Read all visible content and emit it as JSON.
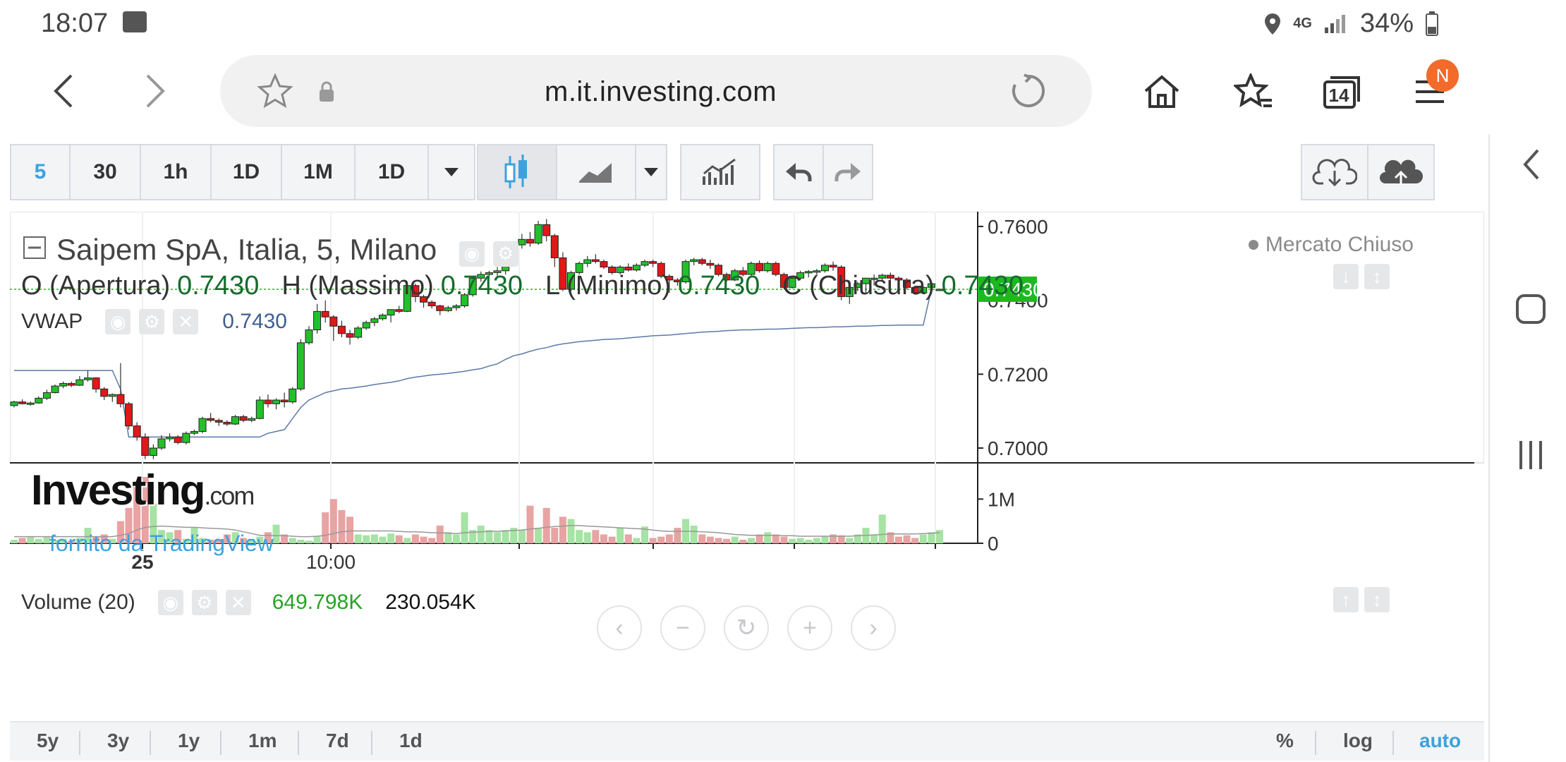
{
  "status_bar": {
    "time": "18:07",
    "network": "4G",
    "battery": "34%",
    "icons": [
      "wifi-icon",
      "location-icon",
      "signal-icon",
      "battery-icon"
    ]
  },
  "browser": {
    "url": "m.it.investing.com",
    "tab_count": "14",
    "notification_badge": "N",
    "icons": [
      "back-icon",
      "forward-icon",
      "star-icon",
      "lock-icon",
      "reload-icon",
      "home-icon",
      "bookmark-star-icon",
      "tabs-icon",
      "menu-icon"
    ]
  },
  "toolbar": {
    "intervals": [
      "5",
      "30",
      "1h",
      "1D",
      "1M",
      "1D"
    ],
    "active_interval": "5",
    "chart_style_icons": [
      "candlestick-icon",
      "line-chart-icon",
      "dropdown-icon"
    ],
    "indicators_icon": "indicators-icon",
    "undo_icon": "undo-icon",
    "redo_icon": "redo-icon",
    "save_icons": [
      "cloud-download-icon",
      "cloud-upload-icon"
    ]
  },
  "legend": {
    "title": "Saipem SpA, Italia, 5, Milano",
    "market_status": "Mercato Chiuso",
    "ohlc": [
      {
        "label": "O (Apertura)",
        "value": "0.7430"
      },
      {
        "label": "H (Massimo)",
        "value": "0.7430"
      },
      {
        "label": "L (Minimo)",
        "value": "0.7430"
      },
      {
        "label": "C (Chiusura)",
        "value": "0.7430"
      }
    ],
    "vwap_label": "VWAP",
    "vwap_value": "0.7430"
  },
  "volume": {
    "label": "Volume (20)",
    "value_a": "649.798K",
    "value_b": "230.054K"
  },
  "watermark": {
    "logo": "Investing",
    "logo_suffix": ".com",
    "provider": "fornito da TradingView"
  },
  "chart_data": {
    "type": "candlestick",
    "price_axis": {
      "ticks": [
        "0.7600",
        "0.7400",
        "0.7200",
        "0.7000"
      ],
      "range": [
        0.696,
        0.764
      ],
      "last_price_label": "0.7430",
      "last_price": 0.743
    },
    "volume_axis": {
      "ticks": [
        "1M",
        "0"
      ],
      "range": [
        0,
        1.5
      ]
    },
    "time_axis": {
      "ticks": [
        "25",
        "10:00"
      ]
    },
    "candles": [
      [
        0.7115,
        0.7128,
        0.711,
        0.7125
      ],
      [
        0.7125,
        0.7132,
        0.7118,
        0.712
      ],
      [
        0.712,
        0.7126,
        0.7115,
        0.7122
      ],
      [
        0.7122,
        0.714,
        0.712,
        0.7135
      ],
      [
        0.7135,
        0.7158,
        0.713,
        0.715
      ],
      [
        0.715,
        0.7172,
        0.7148,
        0.7168
      ],
      [
        0.7168,
        0.718,
        0.7162,
        0.7175
      ],
      [
        0.7175,
        0.718,
        0.7165,
        0.717
      ],
      [
        0.717,
        0.7195,
        0.7168,
        0.7185
      ],
      [
        0.7185,
        0.721,
        0.718,
        0.719
      ],
      [
        0.719,
        0.7192,
        0.715,
        0.716
      ],
      [
        0.716,
        0.7165,
        0.713,
        0.714
      ],
      [
        0.714,
        0.7148,
        0.7125,
        0.7145
      ],
      [
        0.7145,
        0.723,
        0.711,
        0.712
      ],
      [
        0.712,
        0.7125,
        0.705,
        0.706
      ],
      [
        0.706,
        0.707,
        0.702,
        0.703
      ],
      [
        0.703,
        0.704,
        0.697,
        0.698
      ],
      [
        0.698,
        0.701,
        0.697,
        0.7
      ],
      [
        0.7,
        0.7035,
        0.6995,
        0.7025
      ],
      [
        0.7025,
        0.704,
        0.7018,
        0.703
      ],
      [
        0.703,
        0.7035,
        0.701,
        0.7015
      ],
      [
        0.7015,
        0.7045,
        0.701,
        0.704
      ],
      [
        0.704,
        0.705,
        0.7035,
        0.7045
      ],
      [
        0.7045,
        0.7085,
        0.704,
        0.708
      ],
      [
        0.708,
        0.7095,
        0.707,
        0.7075
      ],
      [
        0.7075,
        0.708,
        0.706,
        0.707
      ],
      [
        0.707,
        0.7075,
        0.706,
        0.7065
      ],
      [
        0.7065,
        0.709,
        0.7062,
        0.7085
      ],
      [
        0.7085,
        0.709,
        0.707,
        0.7075
      ],
      [
        0.7075,
        0.7085,
        0.707,
        0.708
      ],
      [
        0.708,
        0.714,
        0.7078,
        0.713
      ],
      [
        0.713,
        0.7145,
        0.711,
        0.712
      ],
      [
        0.712,
        0.7135,
        0.7105,
        0.713
      ],
      [
        0.713,
        0.715,
        0.711,
        0.7125
      ],
      [
        0.7125,
        0.7165,
        0.712,
        0.716
      ],
      [
        0.716,
        0.7295,
        0.7155,
        0.7285
      ],
      [
        0.7285,
        0.733,
        0.728,
        0.732
      ],
      [
        0.732,
        0.739,
        0.731,
        0.737
      ],
      [
        0.737,
        0.74,
        0.734,
        0.7355
      ],
      [
        0.7355,
        0.736,
        0.729,
        0.733
      ],
      [
        0.733,
        0.7345,
        0.73,
        0.731
      ],
      [
        0.731,
        0.732,
        0.728,
        0.73
      ],
      [
        0.73,
        0.733,
        0.7295,
        0.7325
      ],
      [
        0.7325,
        0.7345,
        0.732,
        0.734
      ],
      [
        0.734,
        0.7355,
        0.733,
        0.735
      ],
      [
        0.735,
        0.7365,
        0.7345,
        0.736
      ],
      [
        0.736,
        0.7375,
        0.734,
        0.7375
      ],
      [
        0.7375,
        0.7385,
        0.7365,
        0.737
      ],
      [
        0.737,
        0.745,
        0.7368,
        0.744
      ],
      [
        0.744,
        0.7445,
        0.7395,
        0.741
      ],
      [
        0.741,
        0.7415,
        0.738,
        0.7395
      ],
      [
        0.7395,
        0.74,
        0.7378,
        0.7385
      ],
      [
        0.7385,
        0.7388,
        0.736,
        0.7372
      ],
      [
        0.7372,
        0.7385,
        0.7368,
        0.738
      ],
      [
        0.738,
        0.739,
        0.7372,
        0.7385
      ],
      [
        0.7385,
        0.742,
        0.738,
        0.7415
      ],
      [
        0.7415,
        0.7465,
        0.741,
        0.746
      ],
      [
        0.746,
        0.7478,
        0.745,
        0.747
      ],
      [
        0.747,
        0.748,
        0.746,
        0.7475
      ],
      [
        0.7475,
        0.749,
        0.7465,
        0.748
      ],
      [
        0.748,
        0.753,
        0.747,
        0.752
      ],
      [
        0.752,
        0.756,
        0.751,
        0.755
      ],
      [
        0.755,
        0.758,
        0.754,
        0.7565
      ],
      [
        0.7565,
        0.7585,
        0.7545,
        0.7555
      ],
      [
        0.7555,
        0.7615,
        0.755,
        0.7605
      ],
      [
        0.7605,
        0.762,
        0.756,
        0.7575
      ],
      [
        0.7575,
        0.758,
        0.749,
        0.7515
      ],
      [
        0.7515,
        0.753,
        0.7425,
        0.743
      ],
      [
        0.743,
        0.748,
        0.7425,
        0.7475
      ],
      [
        0.7475,
        0.7505,
        0.747,
        0.75
      ],
      [
        0.75,
        0.752,
        0.749,
        0.751
      ],
      [
        0.751,
        0.7525,
        0.75,
        0.7505
      ],
      [
        0.7505,
        0.751,
        0.7485,
        0.749
      ],
      [
        0.749,
        0.7495,
        0.747,
        0.7475
      ],
      [
        0.7475,
        0.7495,
        0.747,
        0.749
      ],
      [
        0.749,
        0.75,
        0.7478,
        0.7482
      ],
      [
        0.7482,
        0.75,
        0.7478,
        0.7495
      ],
      [
        0.7495,
        0.751,
        0.749,
        0.7505
      ],
      [
        0.7505,
        0.751,
        0.749,
        0.75
      ],
      [
        0.75,
        0.7505,
        0.746,
        0.7465
      ],
      [
        0.7465,
        0.747,
        0.742,
        0.7455
      ],
      [
        0.7455,
        0.746,
        0.744,
        0.745
      ],
      [
        0.745,
        0.751,
        0.7445,
        0.7505
      ],
      [
        0.7505,
        0.7515,
        0.7495,
        0.751
      ],
      [
        0.751,
        0.7515,
        0.7495,
        0.75
      ],
      [
        0.75,
        0.751,
        0.7485,
        0.7495
      ],
      [
        0.7495,
        0.75,
        0.7465,
        0.747
      ],
      [
        0.747,
        0.7475,
        0.745,
        0.7455
      ],
      [
        0.7455,
        0.7485,
        0.7452,
        0.748
      ],
      [
        0.748,
        0.749,
        0.7465,
        0.747
      ],
      [
        0.747,
        0.7505,
        0.7465,
        0.75
      ],
      [
        0.75,
        0.7508,
        0.7475,
        0.748
      ],
      [
        0.748,
        0.7505,
        0.7475,
        0.75
      ],
      [
        0.75,
        0.7505,
        0.7465,
        0.747
      ],
      [
        0.747,
        0.7475,
        0.743,
        0.7435
      ],
      [
        0.7435,
        0.7465,
        0.7432,
        0.746
      ],
      [
        0.746,
        0.748,
        0.7455,
        0.7475
      ],
      [
        0.7475,
        0.7482,
        0.7462,
        0.7478
      ],
      [
        0.7478,
        0.7485,
        0.747,
        0.748
      ],
      [
        0.748,
        0.75,
        0.7475,
        0.7495
      ],
      [
        0.7495,
        0.7505,
        0.748,
        0.749
      ],
      [
        0.749,
        0.7495,
        0.74,
        0.741
      ],
      [
        0.741,
        0.744,
        0.739,
        0.7435
      ],
      [
        0.7435,
        0.745,
        0.7425,
        0.7445
      ],
      [
        0.7445,
        0.7455,
        0.742,
        0.746
      ],
      [
        0.746,
        0.747,
        0.744,
        0.746
      ],
      [
        0.746,
        0.7472,
        0.7455,
        0.7468
      ],
      [
        0.7468,
        0.7475,
        0.7455,
        0.746
      ],
      [
        0.746,
        0.7465,
        0.745,
        0.7455
      ],
      [
        0.7455,
        0.746,
        0.743,
        0.7435
      ],
      [
        0.7435,
        0.744,
        0.7415,
        0.742
      ],
      [
        0.742,
        0.744,
        0.7418,
        0.7435
      ],
      [
        0.7435,
        0.7448,
        0.743,
        0.7445
      ],
      [
        0.743,
        0.7432,
        0.7428,
        0.743
      ]
    ],
    "vwap": [
      0.721,
      0.721,
      0.721,
      0.721,
      0.721,
      0.721,
      0.721,
      0.721,
      0.721,
      0.721,
      0.721,
      0.721,
      0.721,
      0.716,
      0.703,
      0.703,
      0.703,
      0.703,
      0.703,
      0.703,
      0.703,
      0.703,
      0.703,
      0.703,
      0.703,
      0.703,
      0.703,
      0.703,
      0.703,
      0.703,
      0.703,
      0.704,
      0.7045,
      0.705,
      0.708,
      0.711,
      0.713,
      0.714,
      0.715,
      0.7155,
      0.716,
      0.7162,
      0.7165,
      0.7168,
      0.7172,
      0.7175,
      0.7178,
      0.7182,
      0.7188,
      0.7192,
      0.7195,
      0.7198,
      0.72,
      0.7202,
      0.7205,
      0.7208,
      0.7212,
      0.7215,
      0.7222,
      0.7228,
      0.724,
      0.725,
      0.7255,
      0.7262,
      0.7268,
      0.7272,
      0.7278,
      0.7282,
      0.7285,
      0.7288,
      0.729,
      0.7292,
      0.7294,
      0.7295,
      0.7296,
      0.7298,
      0.73,
      0.7302,
      0.7304,
      0.7305,
      0.7306,
      0.7308,
      0.731,
      0.7312,
      0.7314,
      0.7315,
      0.7316,
      0.7318,
      0.7319,
      0.732,
      0.732,
      0.7321,
      0.7322,
      0.7322,
      0.7323,
      0.7324,
      0.7325,
      0.7326,
      0.7326,
      0.7327,
      0.7328,
      0.7328,
      0.7329,
      0.733,
      0.733,
      0.7331,
      0.7332,
      0.7332,
      0.7333,
      0.7333,
      0.7333,
      0.7333,
      0.743
    ],
    "volume": [
      0.08,
      0.12,
      0.15,
      0.1,
      0.14,
      0.08,
      0.1,
      0.06,
      0.12,
      0.35,
      0.15,
      0.2,
      0.1,
      0.5,
      0.8,
      1.4,
      1.5,
      0.9,
      0.3,
      0.25,
      0.3,
      0.1,
      0.35,
      0.12,
      0.08,
      0.1,
      0.2,
      0.25,
      0.12,
      0.1,
      0.15,
      0.25,
      0.42,
      0.2,
      0.12,
      0.08,
      0.06,
      0.15,
      0.7,
      1.0,
      0.75,
      0.6,
      0.2,
      0.18,
      0.2,
      0.15,
      0.22,
      0.18,
      0.12,
      0.2,
      0.15,
      0.12,
      0.4,
      0.25,
      0.2,
      0.7,
      0.3,
      0.4,
      0.3,
      0.25,
      0.3,
      0.35,
      0.3,
      0.85,
      0.35,
      0.8,
      0.35,
      0.6,
      0.55,
      0.3,
      0.25,
      0.3,
      0.2,
      0.15,
      0.35,
      0.2,
      0.12,
      0.38,
      0.12,
      0.15,
      0.2,
      0.35,
      0.55,
      0.4,
      0.2,
      0.15,
      0.12,
      0.1,
      0.15,
      0.08,
      0.12,
      0.2,
      0.25,
      0.2,
      0.15,
      0.1,
      0.12,
      0.08,
      0.12,
      0.15,
      0.2,
      0.18,
      0.12,
      0.2,
      0.35,
      0.2,
      0.65,
      0.25,
      0.15,
      0.18,
      0.12,
      0.2,
      0.25,
      0.3,
      0.35,
      0.65
    ],
    "volume_ma": [
      0.15,
      0.15,
      0.15,
      0.15,
      0.15,
      0.15,
      0.15,
      0.15,
      0.15,
      0.15,
      0.15,
      0.15,
      0.15,
      0.18,
      0.22,
      0.3,
      0.36,
      0.38,
      0.39,
      0.38,
      0.37,
      0.36,
      0.36,
      0.35,
      0.34,
      0.33,
      0.32,
      0.3,
      0.26,
      0.22,
      0.18,
      0.18,
      0.17,
      0.17,
      0.16,
      0.15,
      0.15,
      0.16,
      0.18,
      0.22,
      0.26,
      0.28,
      0.28,
      0.28,
      0.28,
      0.28,
      0.28,
      0.27,
      0.26,
      0.26,
      0.25,
      0.24,
      0.24,
      0.23,
      0.22,
      0.24,
      0.25,
      0.26,
      0.27,
      0.27,
      0.28,
      0.29,
      0.3,
      0.32,
      0.34,
      0.36,
      0.38,
      0.39,
      0.4,
      0.4,
      0.39,
      0.38,
      0.37,
      0.36,
      0.35,
      0.34,
      0.33,
      0.32,
      0.3,
      0.28,
      0.27,
      0.27,
      0.27,
      0.27,
      0.26,
      0.25,
      0.24,
      0.22,
      0.2,
      0.19,
      0.18,
      0.18,
      0.18,
      0.18,
      0.17,
      0.17,
      0.16,
      0.16,
      0.16,
      0.16,
      0.16,
      0.16,
      0.16,
      0.17,
      0.18,
      0.19,
      0.2,
      0.21,
      0.21,
      0.21,
      0.21,
      0.22,
      0.23,
      0.24,
      0.25,
      0.27
    ],
    "colors": {
      "up": "#22c02a",
      "down": "#e01818",
      "vwap": "#5a7aa8",
      "vol_up": "#a6e3a4",
      "vol_down": "#e8a3a3",
      "last_price": "#1db91f"
    }
  },
  "bottom_ranges": [
    "5y",
    "3y",
    "1y",
    "1m",
    "7d",
    "1d"
  ],
  "bottom_right": {
    "percent": "%",
    "log": "log",
    "auto": "auto"
  },
  "zoom_controls": [
    "scroll-left-icon",
    "zoom-out-icon",
    "reset-icon",
    "zoom-in-icon",
    "scroll-right-icon"
  ],
  "side_nav_icons": [
    "side-back-icon",
    "home-square-icon",
    "recents-icon"
  ]
}
